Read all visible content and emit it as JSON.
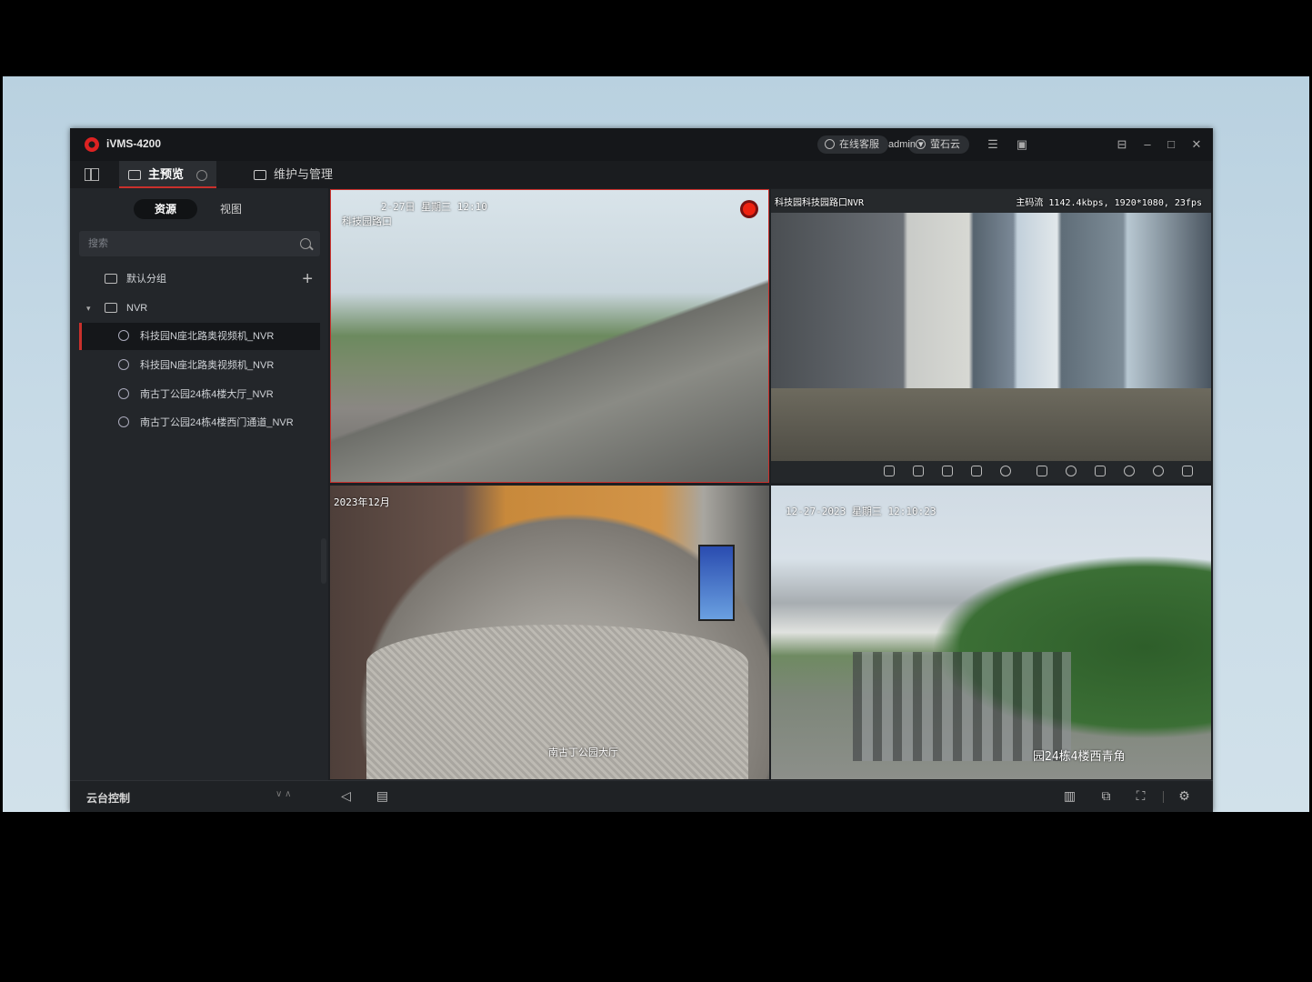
{
  "app": {
    "title": "iVMS-4200",
    "pill_online": "在线客服",
    "pill_cloud": "萤石云",
    "user": "admin",
    "user_caret": "▾"
  },
  "tabs": [
    {
      "label": "主预览"
    },
    {
      "label": "维护与管理"
    }
  ],
  "sidebar": {
    "seg_resources": "资源",
    "seg_views": "视图",
    "search_placeholder": "搜索",
    "tree": [
      {
        "label": "默认分组"
      },
      {
        "label": "NVR"
      },
      {
        "label": "科技园N座北路奥视频机_NVR"
      },
      {
        "label": "科技园N座北路奥视频机_NVR"
      },
      {
        "label": "南古丁公园24栋4楼大厅_NVR"
      },
      {
        "label": "南古丁公园24栋4楼西门通道_NVR"
      }
    ],
    "ptz_label": "云台控制",
    "ptz_chevrons": "∨  ∧"
  },
  "videos": {
    "v1": {
      "osd_time": "2-27日  星期三  12:10",
      "osd_name": "科技园路口"
    },
    "v2": {
      "osd_name": "科技园科技园路口NVR",
      "osd_info": "主码流 1142.4kbps, 1920*1080, 23fps"
    },
    "v3": {
      "osd_time": "2023年12月",
      "osd_caption": "南古丁公园大厅"
    },
    "v4": {
      "osd_time": "12-27-2023  星期三  12:10:23",
      "osd_caption": "园24栋4楼西青角"
    }
  },
  "colors": {
    "accent": "#c9302c",
    "panel": "#23262a",
    "titlebar": "#15171a"
  },
  "icons": {
    "titlebar": [
      "list-icon",
      "screenshot-icon",
      "lock-icon",
      "minimize-icon",
      "maximize-icon",
      "close-icon"
    ],
    "bottom": [
      "volume-icon",
      "record-icon",
      "layout-icon",
      "window-icon",
      "fullscreen-icon",
      "settings-icon"
    ]
  }
}
